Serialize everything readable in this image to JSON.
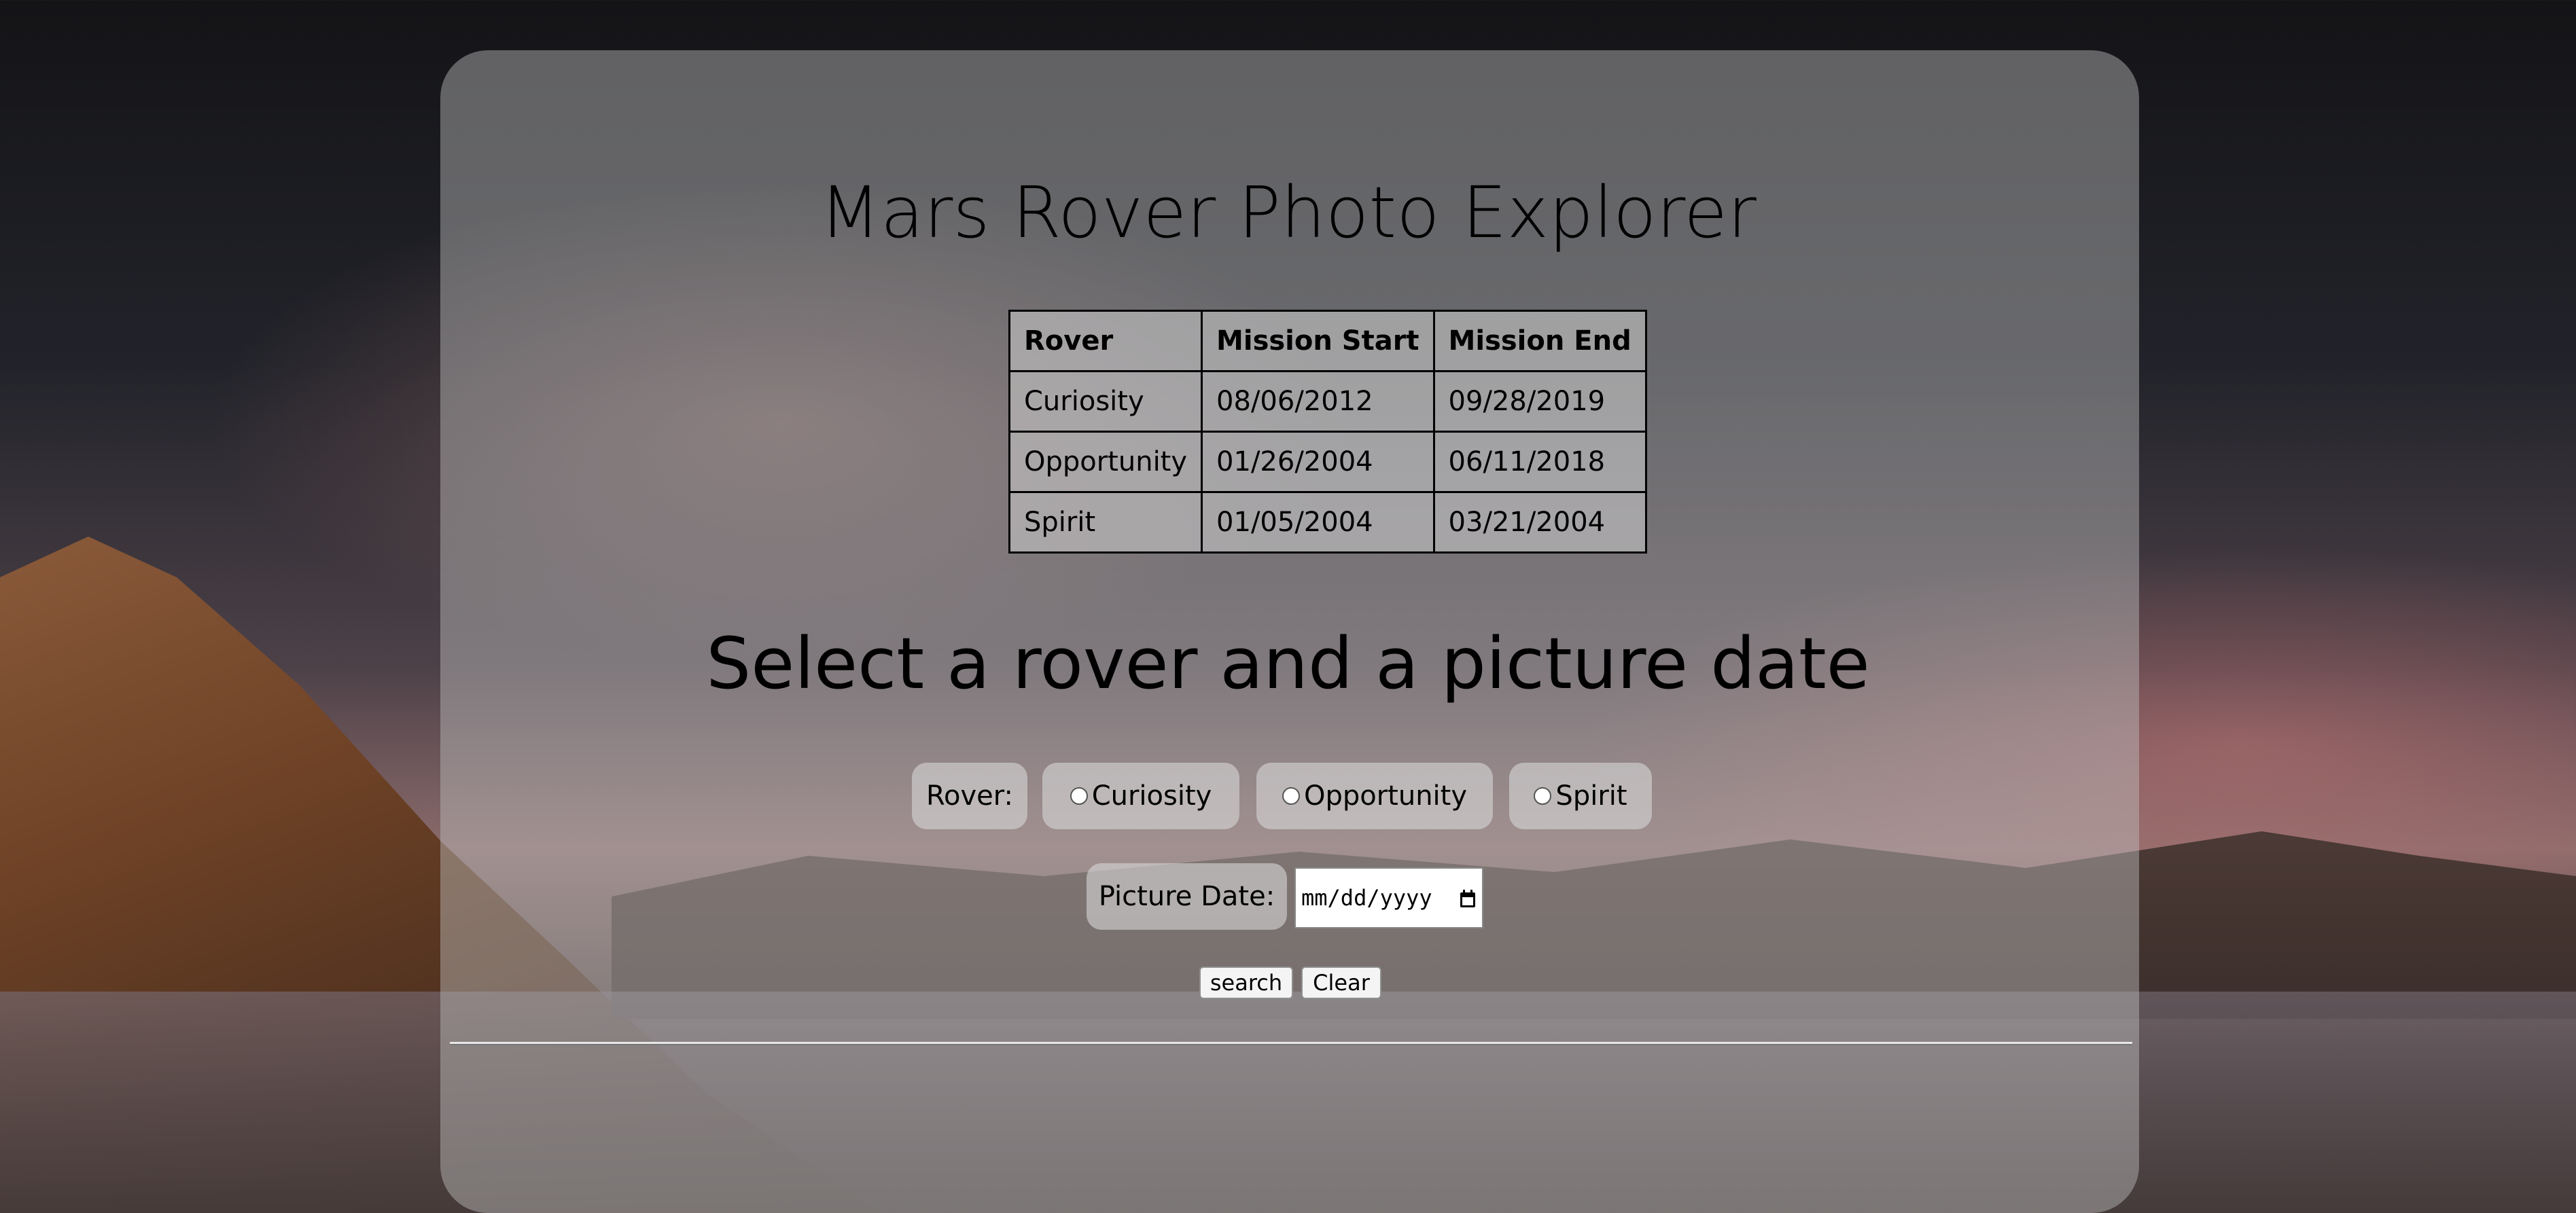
{
  "app": {
    "title": "Mars Rover Photo Explorer"
  },
  "mission_table": {
    "headers": [
      "Rover",
      "Mission Start",
      "Mission End"
    ],
    "rows": [
      [
        "Curiosity",
        "08/06/2012",
        "09/28/2019"
      ],
      [
        "Opportunity",
        "01/26/2004",
        "06/11/2018"
      ],
      [
        "Spirit",
        "01/05/2004",
        "03/21/2004"
      ]
    ]
  },
  "form": {
    "heading": "Select a rover and a picture date",
    "rover_label": "Rover:",
    "rover_options": [
      {
        "label": "Curiosity",
        "selected": false
      },
      {
        "label": "Opportunity",
        "selected": false
      },
      {
        "label": "Spirit",
        "selected": false
      }
    ],
    "date_label": "Picture Date:",
    "date_placeholder": "mm/dd/yyyy",
    "search_label": "search",
    "clear_label": "Clear"
  },
  "icons": {
    "radio": "radio-unchecked-icon",
    "calendar": "calendar-icon"
  }
}
